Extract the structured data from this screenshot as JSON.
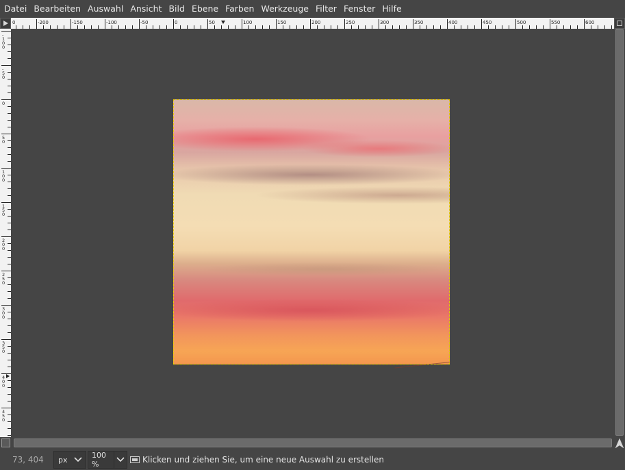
{
  "menu": {
    "items": [
      "Datei",
      "Bearbeiten",
      "Auswahl",
      "Ansicht",
      "Bild",
      "Ebene",
      "Farben",
      "Werkzeuge",
      "Filter",
      "Fenster",
      "Hilfe"
    ]
  },
  "rulers": {
    "horizontal_labels": [
      "0",
      "-200",
      "-150",
      "-100",
      "-50",
      "0",
      "50",
      "100",
      "150",
      "200",
      "250",
      "300",
      "350",
      "400",
      "450",
      "500",
      "550",
      "600"
    ],
    "vertical_labels": [
      "-100",
      "-50",
      "0",
      "50",
      "100",
      "150",
      "200",
      "250",
      "300",
      "350",
      "400",
      "450",
      "500"
    ]
  },
  "status": {
    "coordinates": "73, 404",
    "unit": "px",
    "zoom": "100 %",
    "message": "Klicken und ziehen Sie, um eine neue Auswahl zu erstellen"
  },
  "icons": {
    "ruler_corner": "triangle-right-icon",
    "navigate": "navigate-icon",
    "quick_mask": "quick-mask-icon",
    "status": "selection-icon"
  },
  "colors": {
    "background": "#454545",
    "selection_marching_ants": "#f0d000"
  }
}
